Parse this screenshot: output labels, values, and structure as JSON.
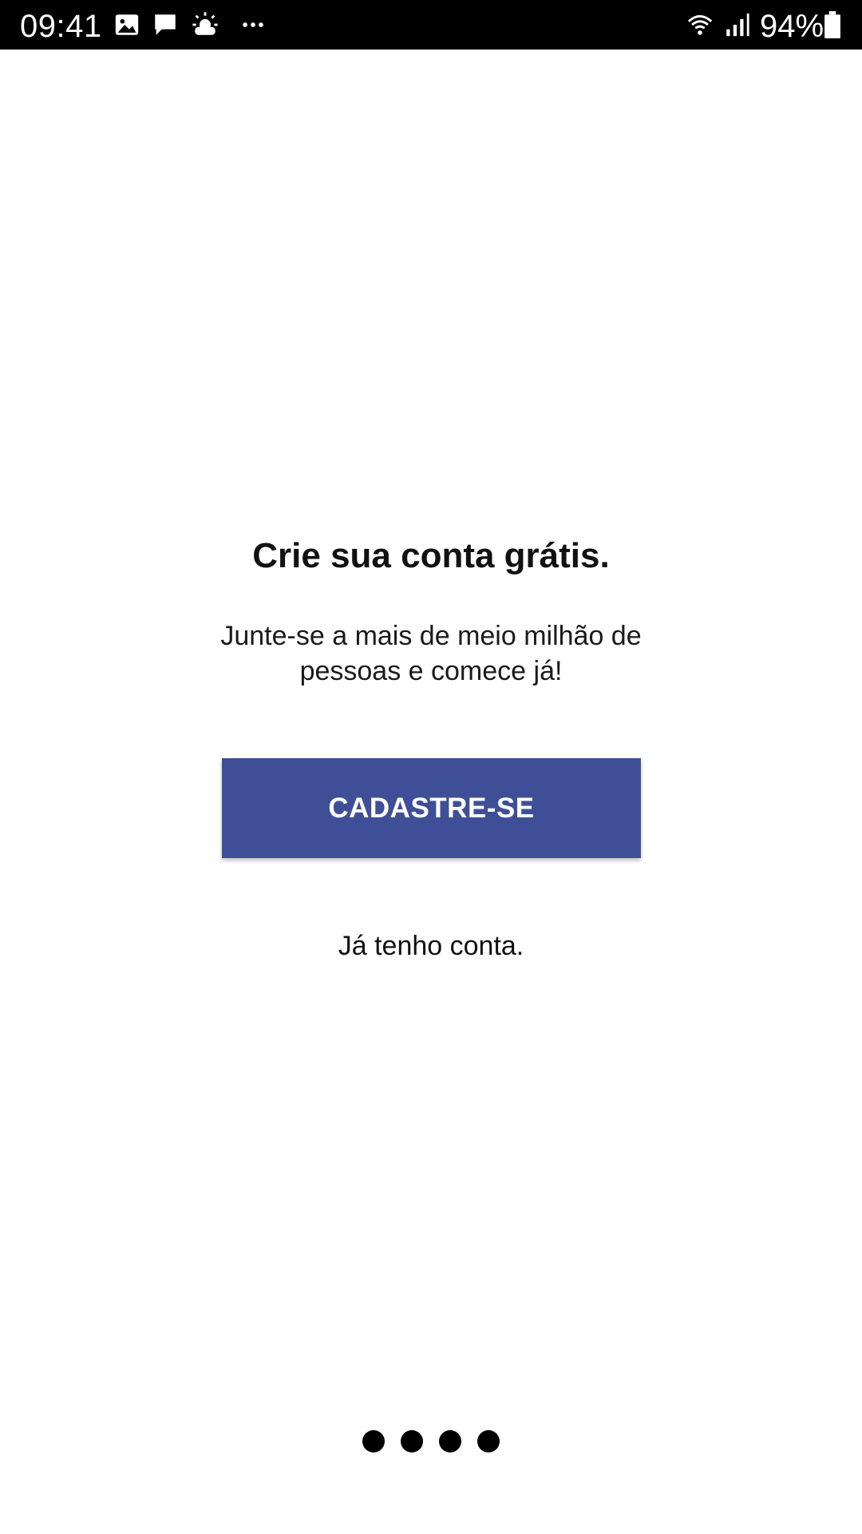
{
  "status_bar": {
    "time": "09:41",
    "left_icons": [
      "gallery-icon",
      "message-icon",
      "weather-icon",
      "more-dots-icon"
    ],
    "right_icons": [
      "wifi-icon",
      "signal-icon",
      "battery-icon"
    ],
    "battery_percent": "94%",
    "battery_level": 0.94
  },
  "onboarding": {
    "title": "Crie sua conta grátis.",
    "subtitle": "Junte-se a mais de meio milhão de pessoas e comece já!",
    "signup_button_label": "CADASTRE-SE",
    "login_link_label": "Já tenho conta.",
    "button_color": "#3f4f97"
  },
  "pager": {
    "page_count": 4,
    "dot_color": "#000000"
  }
}
